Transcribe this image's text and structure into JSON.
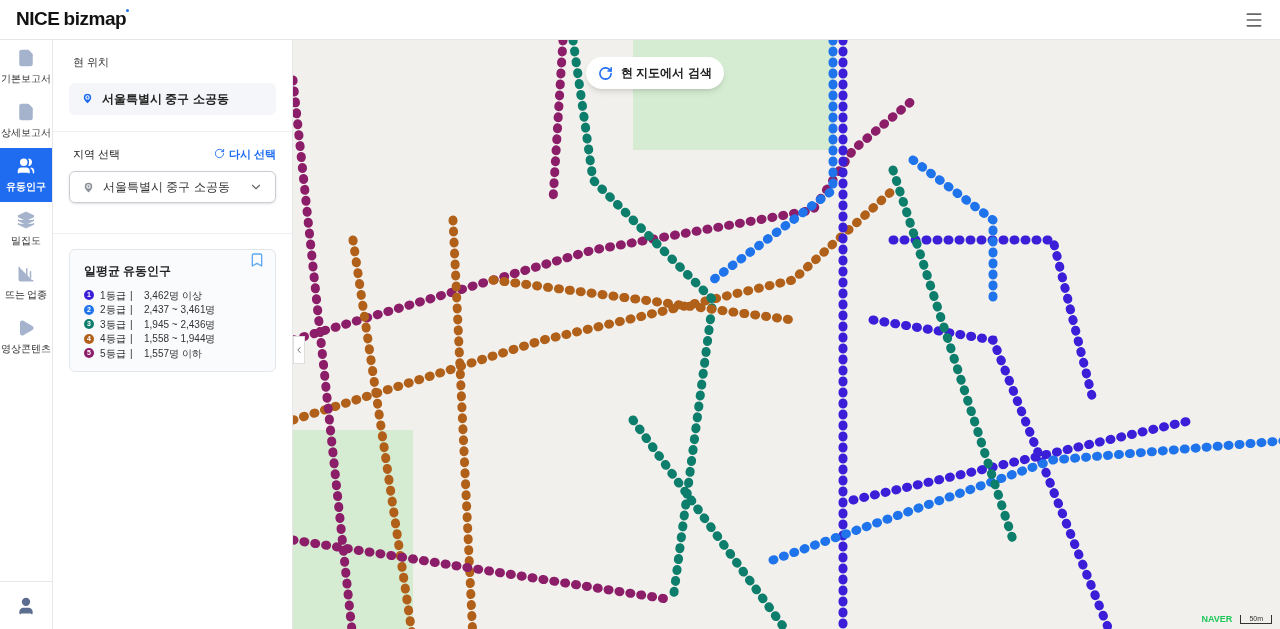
{
  "header": {
    "logo": {
      "bold": "NICE",
      "light": "bizmap"
    }
  },
  "sidebar": {
    "items": [
      {
        "kind": "report",
        "label": "기본보고서",
        "selected": false
      },
      {
        "kind": "detail",
        "label": "상세보고서",
        "selected": false
      },
      {
        "kind": "people",
        "label": "유동인구",
        "selected": true
      },
      {
        "kind": "layers",
        "label": "밀집도",
        "selected": false
      },
      {
        "kind": "chart",
        "label": "뜨는 업종",
        "selected": false
      },
      {
        "kind": "video",
        "label": "영상콘텐츠",
        "selected": false
      }
    ]
  },
  "panel": {
    "current_location": {
      "label": "현 위치",
      "value": "서울특별시 중구 소공동"
    },
    "region_select": {
      "label": "지역 선택",
      "reset_button": "다시 선택",
      "value": "서울특별시 중구 소공동"
    },
    "legend": {
      "title": "일평균 유동인구",
      "grades": [
        {
          "badge": "1",
          "label": "1등급",
          "separator": "|",
          "range": "3,462명 이상",
          "color": "#3a1ed8"
        },
        {
          "badge": "2",
          "label": "2등급",
          "separator": "|",
          "range": "2,437 ~ 3,461명",
          "color": "#1f74ec"
        },
        {
          "badge": "3",
          "label": "3등급",
          "separator": "|",
          "range": "1,945 ~ 2,436명",
          "color": "#0d7d6c"
        },
        {
          "badge": "4",
          "label": "4등급",
          "separator": "|",
          "range": "1,558 ~ 1,944명",
          "color": "#b1601a"
        },
        {
          "badge": "5",
          "label": "5등급",
          "separator": "|",
          "range": "1,557명 이하",
          "color": "#8c1d68"
        }
      ]
    }
  },
  "map": {
    "search_button": "현 지도에서 검색",
    "provider": "NAVER",
    "scale": "50m"
  }
}
